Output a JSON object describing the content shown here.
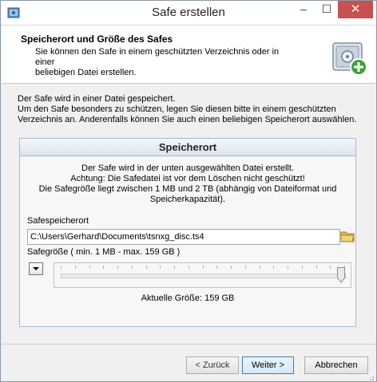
{
  "window": {
    "title": "Safe erstellen",
    "minimize_glyph": "–",
    "maximize_glyph": "☐",
    "close_glyph": "✕"
  },
  "header": {
    "title": "Speicherort und Größe des Safes",
    "description_1": "Sie können den Safe in einem geschützten Verzeichnis oder in einer",
    "description_2": "beliebigen Datei erstellen.",
    "icon": "safe-add-icon"
  },
  "intro": {
    "line_1": "Der Safe wird in einer Datei gespeichert.",
    "line_2": "Um den Safe besonders zu schützen, legen Sie diesen bitte in einem geschützten",
    "line_3": "Verzeichnis an. Anderenfalls können Sie auch einen beliebigen Speicherort auswählen."
  },
  "group": {
    "title": "Speicherort",
    "text_1": "Der Safe wird in der unten ausgewählten Datei erstellt.",
    "text_2": "Achtung: Die Safedatei ist vor dem Löschen nicht geschützt!",
    "text_3": "Die Safegröße liegt zwischen 1 MB und 2 TB (abhängig von Dateiformat und",
    "text_4": "Speicherkapazität).",
    "location_label": "Safespeicherort",
    "location_value": "C:\\Users\\Gerhard\\Documents\\tsnxg_disc.ts4",
    "size_label": "Safegröße ( min. 1 MB - max. 159 GB )",
    "size_slider_fraction": 1.0,
    "current_size": "Aktuelle Größe: 159 GB"
  },
  "buttons": {
    "back": "< Zurück",
    "next": "Weiter >",
    "cancel": "Abbrechen"
  },
  "colors": {
    "close": "#c75050",
    "next_border": "#3c7fb1"
  }
}
